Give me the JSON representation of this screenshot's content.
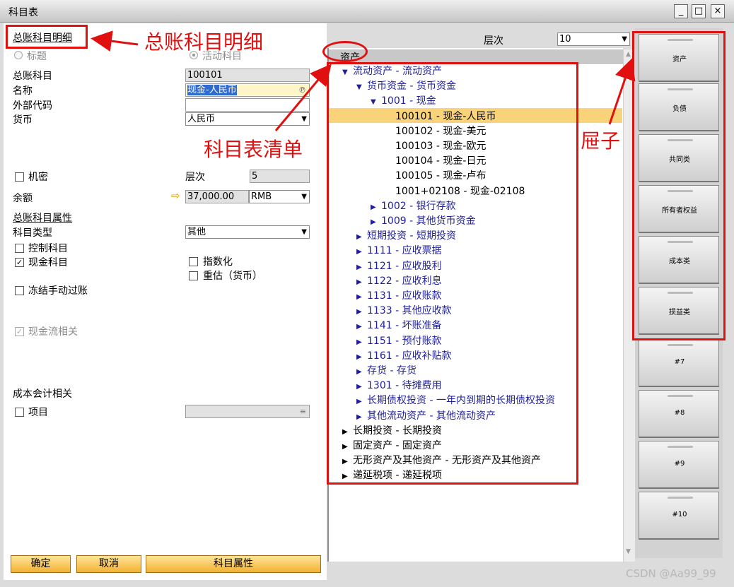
{
  "window": {
    "title": "科目表",
    "min": "_",
    "max": "□",
    "close": "×"
  },
  "left": {
    "detail_heading": "总账科目明细",
    "radio_title": "标题",
    "radio_active": "活动科目",
    "gl_account_label": "总账科目",
    "gl_account_value": "100101",
    "name_label": "名称",
    "name_value": "现金-人民币",
    "external_code_label": "外部代码",
    "external_code_value": "",
    "currency_label": "货币",
    "currency_value": "人民币",
    "confidential_label": "机密",
    "level_label": "层次",
    "level_value": "5",
    "balance_label": "余额",
    "balance_value": "37,000.00",
    "balance_currency": "RMB",
    "properties_heading": "总账科目属性",
    "account_type_label": "科目类型",
    "account_type_value": "其他",
    "control_account_label": "控制科目",
    "cash_account_label": "现金科目",
    "indexed_label": "指数化",
    "revalue_label": "重估（货币）",
    "freeze_manual_label": "冻结手动过账",
    "cashflow_label": "现金流相关",
    "cost_accounting_heading": "成本会计相关",
    "project_label": "项目"
  },
  "buttons": {
    "ok": "确定",
    "cancel": "取消",
    "properties": "科目属性"
  },
  "top": {
    "level_label": "层次",
    "level_value": "10"
  },
  "tree": {
    "header": "资产",
    "rows": [
      {
        "text": "流动资产 - 流动资产",
        "indent": 0,
        "toggle": "▼",
        "color": "blue"
      },
      {
        "text": "货币资金 - 货币资金",
        "indent": 1,
        "toggle": "▼",
        "color": "blue"
      },
      {
        "text": "1001 - 现金",
        "indent": 2,
        "toggle": "▼",
        "color": "blue"
      },
      {
        "text": "100101 - 现金-人民币",
        "indent": 3,
        "toggle": "",
        "color": "dark"
      },
      {
        "text": "100102 - 现金-美元",
        "indent": 3,
        "toggle": "",
        "color": "dark"
      },
      {
        "text": "100103 - 现金-欧元",
        "indent": 3,
        "toggle": "",
        "color": "dark"
      },
      {
        "text": "100104 - 现金-日元",
        "indent": 3,
        "toggle": "",
        "color": "dark"
      },
      {
        "text": "100105 - 现金-卢布",
        "indent": 3,
        "toggle": "",
        "color": "dark"
      },
      {
        "text": "1001+02108 - 现金-02108",
        "indent": 3,
        "toggle": "",
        "color": "dark"
      },
      {
        "text": "1002 - 银行存款",
        "indent": 2,
        "toggle": "▶",
        "color": "blue"
      },
      {
        "text": "1009 - 其他货币资金",
        "indent": 2,
        "toggle": "▶",
        "color": "blue"
      },
      {
        "text": "短期投资 - 短期投资",
        "indent": 1,
        "toggle": "▶",
        "color": "blue"
      },
      {
        "text": "1111 - 应收票据",
        "indent": 1,
        "toggle": "▶",
        "color": "blue"
      },
      {
        "text": "1121 - 应收股利",
        "indent": 1,
        "toggle": "▶",
        "color": "blue"
      },
      {
        "text": "1122 - 应收利息",
        "indent": 1,
        "toggle": "▶",
        "color": "blue"
      },
      {
        "text": "1131 - 应收账款",
        "indent": 1,
        "toggle": "▶",
        "color": "blue"
      },
      {
        "text": "1133 - 其他应收款",
        "indent": 1,
        "toggle": "▶",
        "color": "blue"
      },
      {
        "text": "1141 - 坏账准备",
        "indent": 1,
        "toggle": "▶",
        "color": "blue"
      },
      {
        "text": "1151 - 预付账款",
        "indent": 1,
        "toggle": "▶",
        "color": "blue"
      },
      {
        "text": "1161 - 应收补贴款",
        "indent": 1,
        "toggle": "▶",
        "color": "blue"
      },
      {
        "text": "存货 - 存货",
        "indent": 1,
        "toggle": "▶",
        "color": "blue"
      },
      {
        "text": "1301 - 待摊费用",
        "indent": 1,
        "toggle": "▶",
        "color": "blue"
      },
      {
        "text": "长期债权投资 - 一年内到期的长期债权投资",
        "indent": 1,
        "toggle": "▶",
        "color": "blue"
      },
      {
        "text": "其他流动资产 - 其他流动资产",
        "indent": 1,
        "toggle": "▶",
        "color": "blue"
      },
      {
        "text": "长期投资 - 长期投资",
        "indent": 0,
        "toggle": "▶",
        "color": "dark"
      },
      {
        "text": "固定资产 - 固定资产",
        "indent": 0,
        "toggle": "▶",
        "color": "dark"
      },
      {
        "text": "无形资产及其他资产 - 无形资产及其他资产",
        "indent": 0,
        "toggle": "▶",
        "color": "dark"
      },
      {
        "text": "递延税项 - 递延税项",
        "indent": 0,
        "toggle": "▶",
        "color": "dark"
      }
    ]
  },
  "drawers": [
    "资产",
    "负债",
    "共同类",
    "所有者权益",
    "成本类",
    "损益类",
    "#7",
    "#8",
    "#9",
    "#10"
  ],
  "annotations": {
    "detail": "总账科目明细",
    "list": "科目表清单",
    "drawers": "屉子",
    "color": "#e01010"
  },
  "watermark": "CSDN @Aa99_99"
}
